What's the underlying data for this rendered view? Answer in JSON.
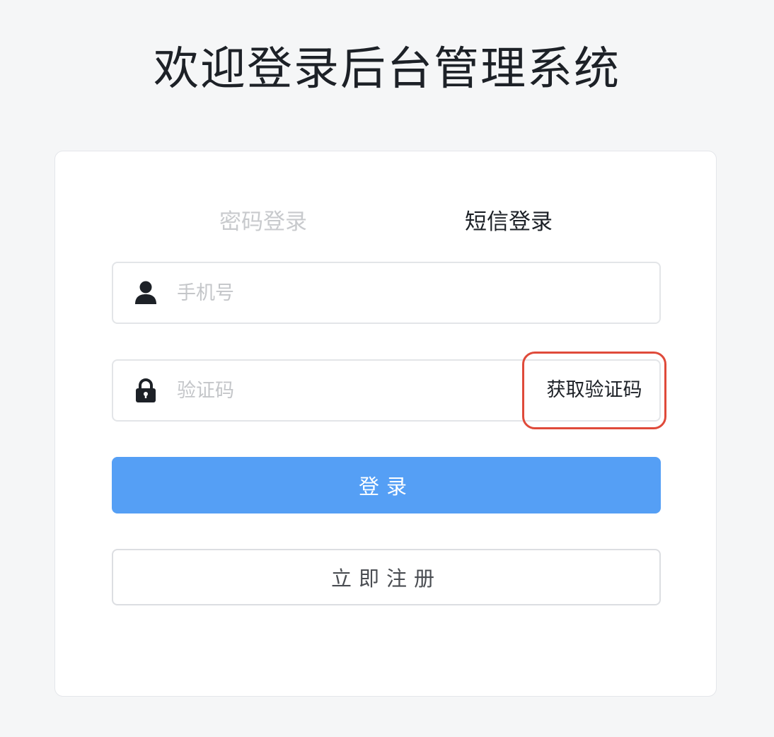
{
  "header": {
    "title": "欢迎登录后台管理系统"
  },
  "tabs": [
    {
      "label": "密码登录",
      "active": false
    },
    {
      "label": "短信登录",
      "active": true
    }
  ],
  "form": {
    "phone": {
      "placeholder": "手机号",
      "value": "",
      "icon": "user-icon"
    },
    "code": {
      "placeholder": "验证码",
      "value": "",
      "icon": "lock-icon"
    },
    "get_code_label": "获取验证码",
    "highlight_color": "#df4a3a"
  },
  "actions": {
    "login_label": "登录",
    "register_label": "立即注册",
    "primary_color": "#559ff5"
  }
}
